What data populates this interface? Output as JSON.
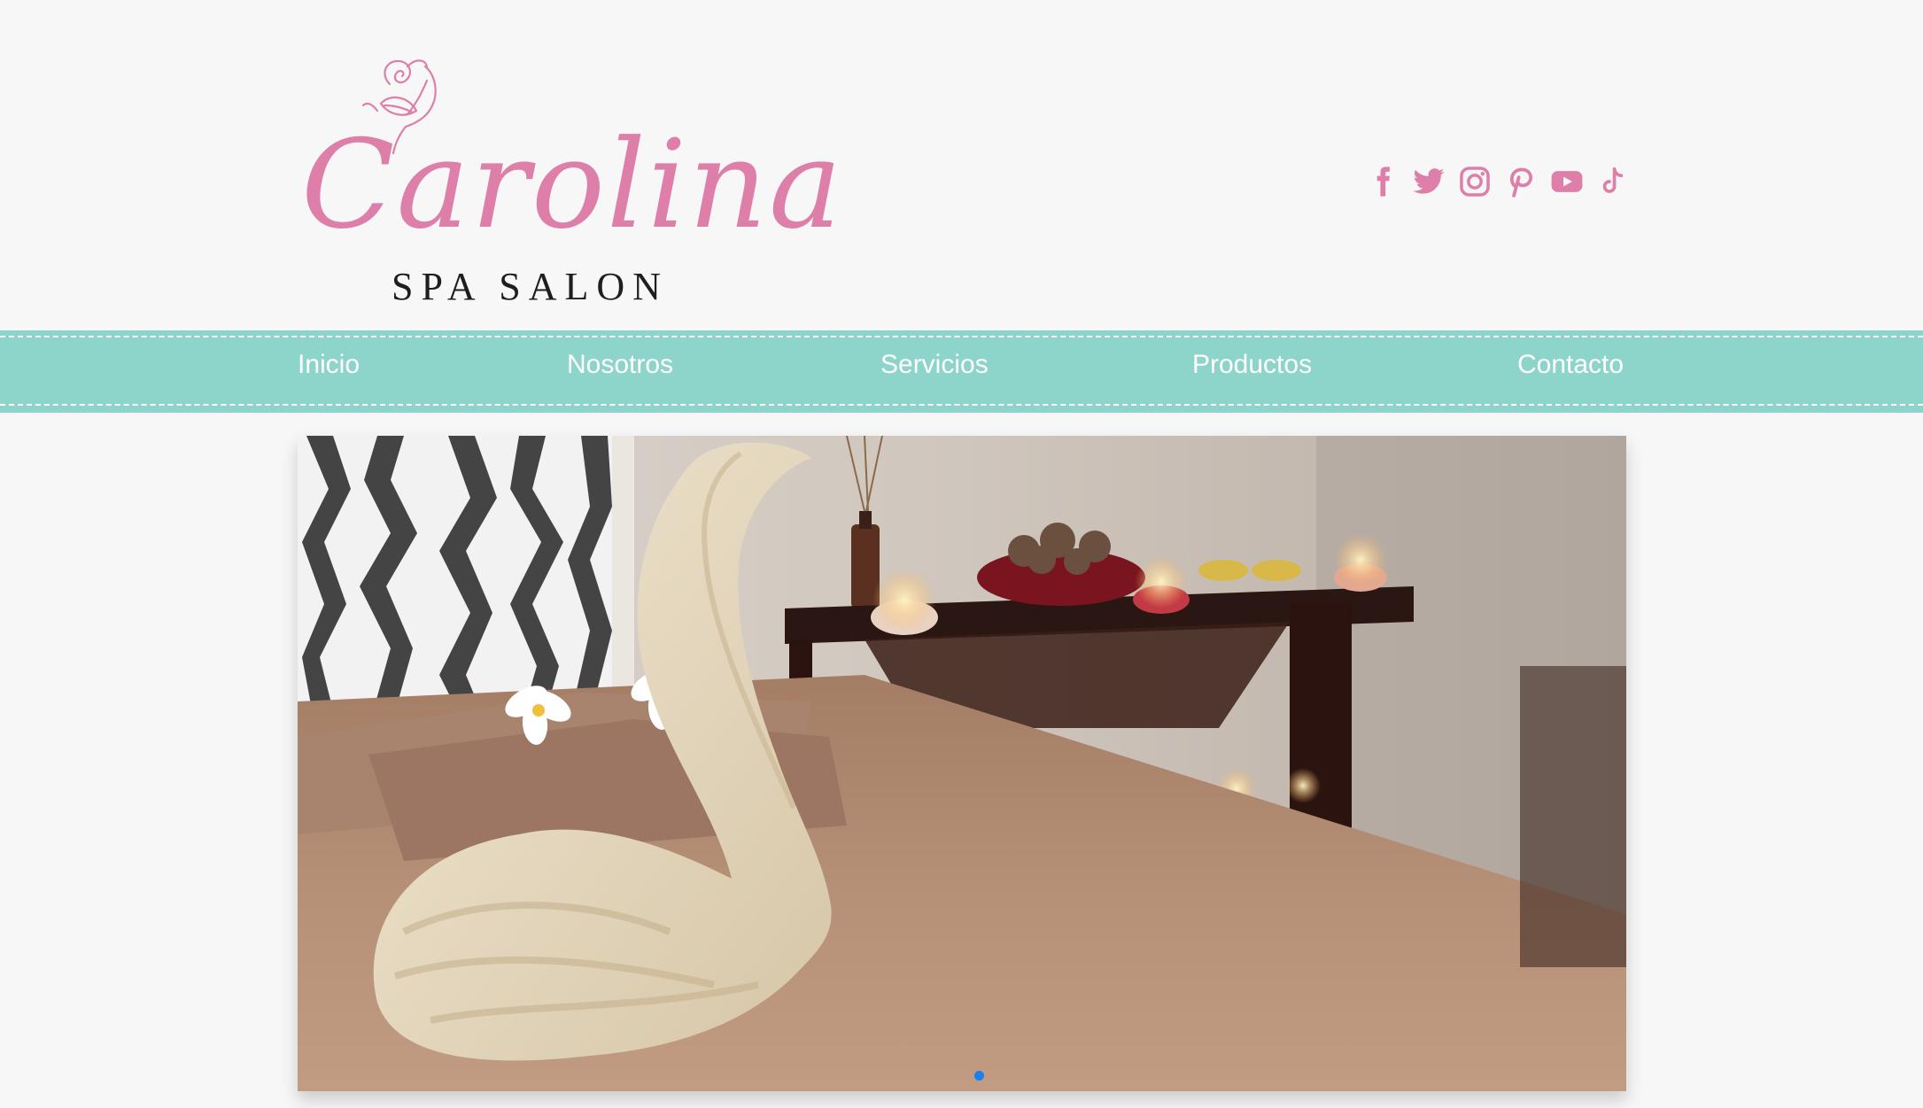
{
  "logo": {
    "script_text": "Carolina",
    "subtitle": "SPA SALON"
  },
  "social": [
    {
      "name": "facebook-icon"
    },
    {
      "name": "twitter-icon"
    },
    {
      "name": "instagram-icon"
    },
    {
      "name": "pinterest-icon"
    },
    {
      "name": "youtube-icon"
    },
    {
      "name": "tiktok-icon"
    }
  ],
  "nav": {
    "items": [
      {
        "label": "Inicio"
      },
      {
        "label": "Nosotros"
      },
      {
        "label": "Servicios"
      },
      {
        "label": "Productos"
      },
      {
        "label": "Contacto"
      }
    ]
  },
  "hero": {
    "image": "spa-massage-table-towel-swan",
    "slide_count": 1,
    "active_slide": 1
  },
  "colors": {
    "background": "#f7f7f7",
    "brand_pink": "#de7fa9",
    "nav_teal": "#8dd4cb",
    "nav_text": "#ffffff",
    "slide_dot": "#1a7ff0"
  }
}
